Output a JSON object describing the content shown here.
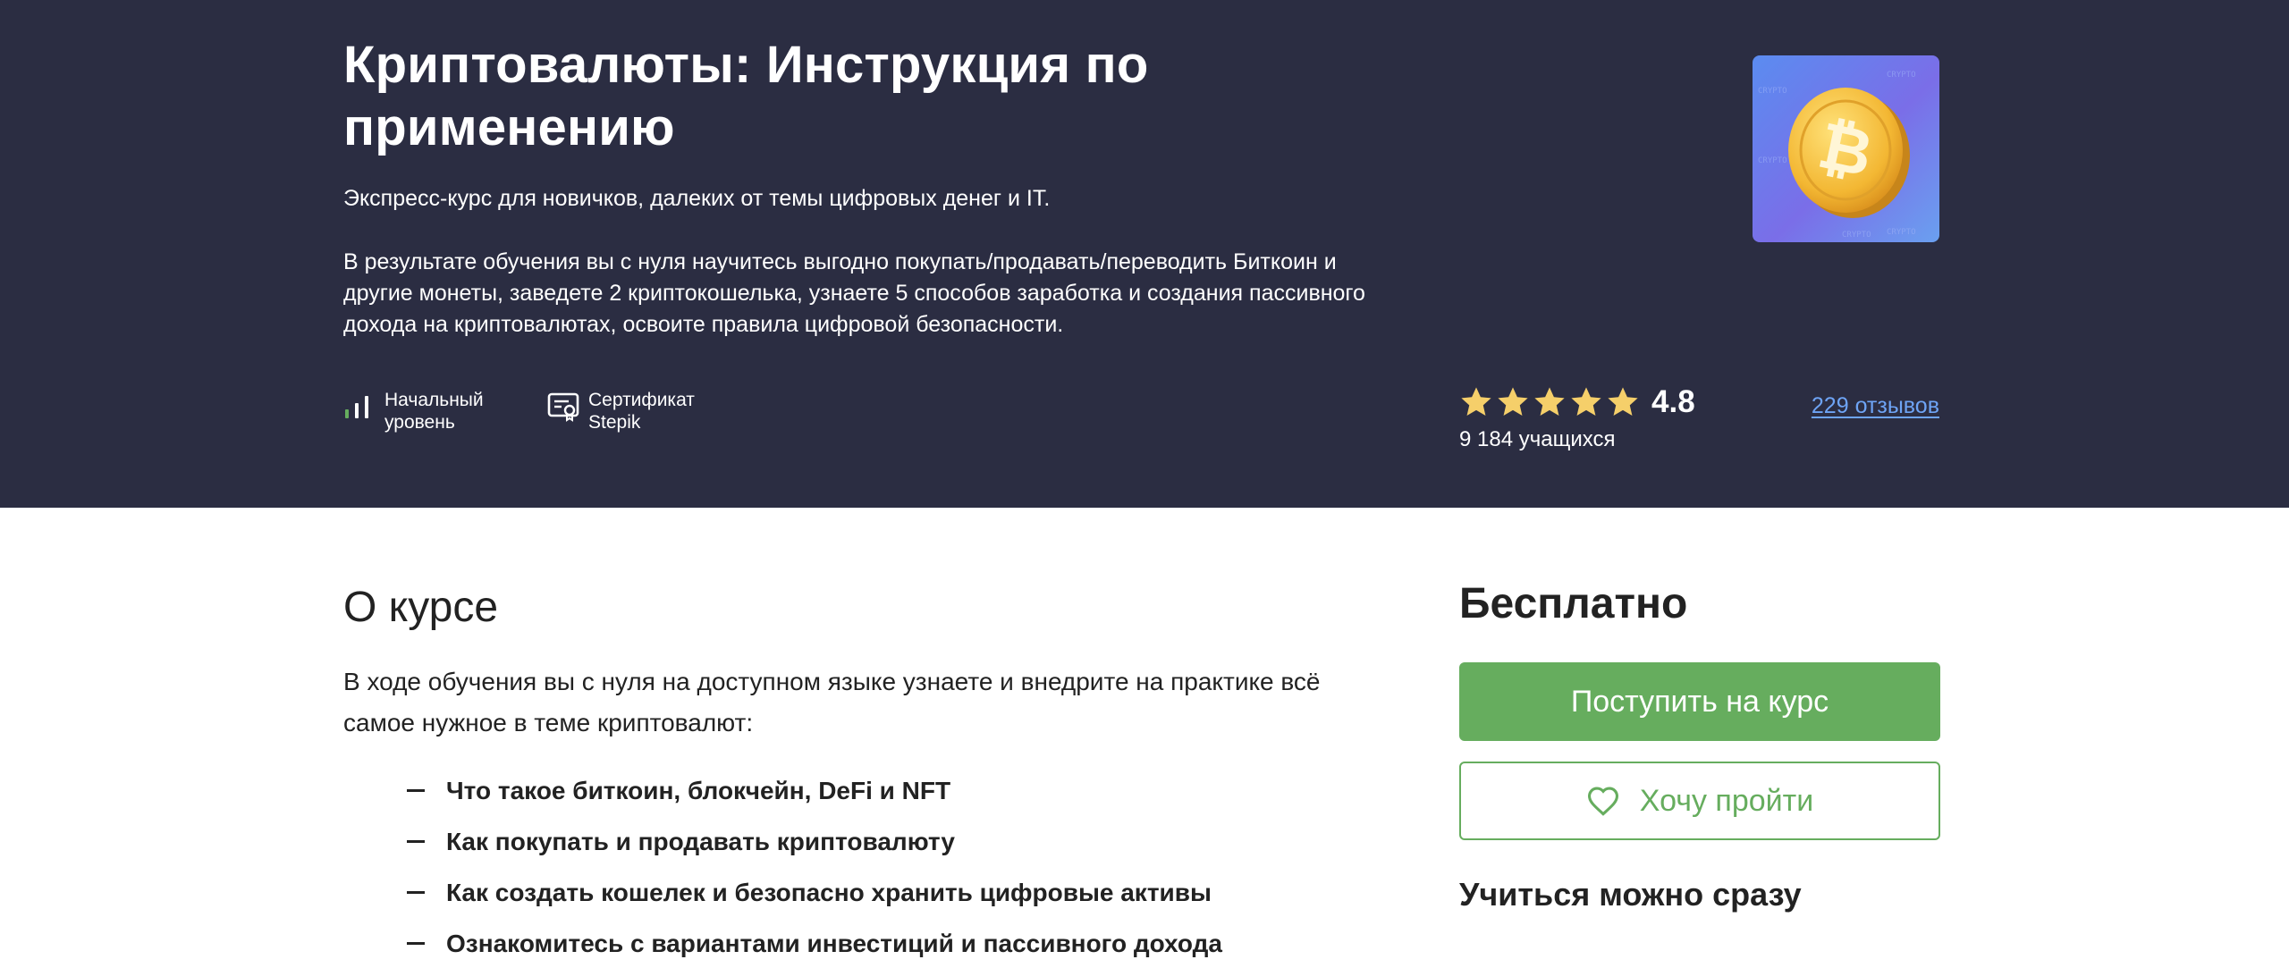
{
  "hero": {
    "title": "Криптовалюты: Инструкция по применению",
    "summary": "Экспресс-курс для новичков, далеких от темы цифровых денег и IT.",
    "description": "В результате обучения вы с нуля научитесь выгодно покупать/продавать/переводить Биткоин и другие монеты, заведете 2 криптокошелька, узнаете 5 способов заработка и создания пассивного дохода на криптовалютах, освоите правила цифровой безопасности.",
    "meta": {
      "level_line1": "Начальный",
      "level_line2": "уровень",
      "cert_line1": "Сертификат",
      "cert_line2": "Stepik"
    },
    "cover_watermark": "CRYPTO",
    "rating": {
      "value": "4.8",
      "stars": 5,
      "students": "9 184 учащихся",
      "reviews_link": "229 отзывов"
    }
  },
  "about": {
    "title": "О курсе",
    "intro": "В ходе обучения вы с нуля на доступном языке узнаете и внедрите на практике всё самое нужное в теме криптовалют:",
    "topics": [
      "Что такое биткоин, блокчейн, DeFi и NFT",
      "Как покупать и продавать криптовалюту",
      "Как создать кошелек и безопасно хранить цифровые активы",
      "Ознакомитесь с вариантами инвестиций и пассивного дохода"
    ]
  },
  "sidebar": {
    "price": "Бесплатно",
    "enroll_label": "Поступить на курс",
    "wishlist_label": "Хочу пройти",
    "start_now": "Учиться можно сразу"
  },
  "colors": {
    "hero_bg": "#2b2d42",
    "accent_green": "#66ad5e",
    "link_blue": "#6ea4f5",
    "star_gold": "#f5cf6a"
  },
  "icons": [
    "level-bars-icon",
    "certificate-icon",
    "star-icon",
    "heart-icon",
    "bitcoin-coin-image"
  ]
}
